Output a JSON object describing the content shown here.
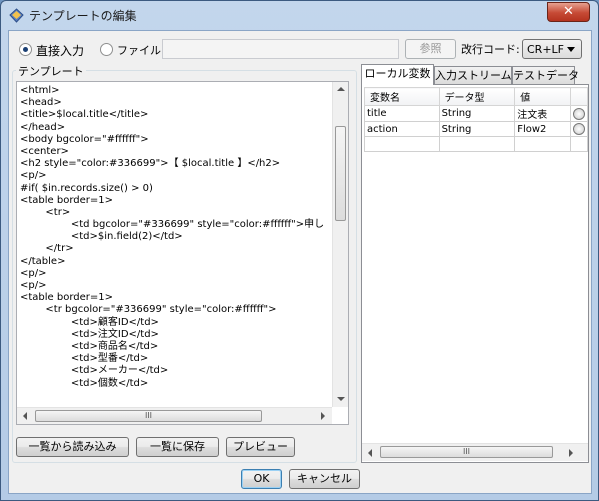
{
  "window": {
    "title": "テンプレートの編集",
    "close_label": "✕"
  },
  "input_mode": {
    "direct_label": "直接入力",
    "file_label": "ファイル",
    "selected": "direct",
    "file_path_value": "",
    "browse_label": "参照",
    "newline_label": "改行コード:",
    "newline_value": "CR+LF"
  },
  "template": {
    "title": "テンプレート",
    "lines": [
      "<html>",
      "<head>",
      "<title>$local.title</title>",
      "</head>",
      "<body bgcolor=\"#ffffff\">",
      "<center>",
      "<h2 style=\"color:#336699\">【 $local.title 】</h2>",
      "<p/>",
      "#if( $in.records.size() > 0)",
      "<table border=1>",
      "        <tr>",
      "                <td bgcolor=\"#336699\" style=\"color:#ffffff\">申し",
      "                <td>$in.field(2)</td>",
      "        </tr>",
      "</table>",
      "<p/>",
      "<p/>",
      "<table border=1>",
      "        <tr bgcolor=\"#336699\" style=\"color:#ffffff\">",
      "                <td>顧客ID</td>",
      "                <td>注文ID</td>",
      "                <td>商品名</td>",
      "                <td>型番</td>",
      "                <td>メーカー</td>",
      "                <td>個数</td>"
    ],
    "hscroll_grip": "III"
  },
  "buttons": {
    "load_from_list": "一覧から読み込み",
    "save_to_list": "一覧に保存",
    "preview": "プレビュー",
    "ok": "OK",
    "cancel": "キャンセル"
  },
  "tabs": [
    {
      "label": "ローカル変数",
      "active": true
    },
    {
      "label": "入力ストリーム",
      "active": false
    },
    {
      "label": "テストデータ",
      "active": false
    }
  ],
  "variables": {
    "columns": [
      "変数名",
      "データ型",
      "値"
    ],
    "rows": [
      {
        "name": "title",
        "type": "String",
        "value": "注文表"
      },
      {
        "name": "action",
        "type": "String",
        "value": "Flow2"
      },
      {
        "name": "",
        "type": "",
        "value": ""
      }
    ],
    "hscroll_grip": "III"
  }
}
